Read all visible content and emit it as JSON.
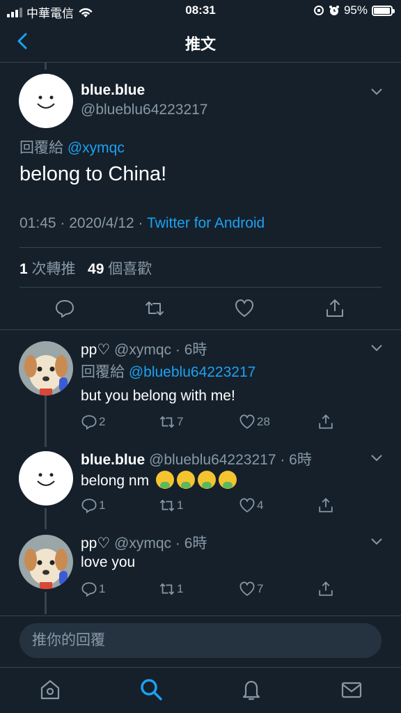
{
  "status": {
    "carrier": "中華電信",
    "time": "08:31",
    "battery": "95%",
    "battery_level": 0.95
  },
  "nav": {
    "title": "推文"
  },
  "main_tweet": {
    "name": "blue.blue",
    "handle": "@blueblu64223217",
    "reply_prefix": "回覆給",
    "reply_to": "@xymqc",
    "text": "belong to China!",
    "time": "01:45",
    "dot1": "·",
    "date": "2020/4/12",
    "dot2": "·",
    "source": "Twitter for Android",
    "retweets": "1",
    "retweets_label": "次轉推",
    "likes": "49",
    "likes_label": "個喜歡"
  },
  "replies": [
    {
      "name": "pp♡",
      "handle": "@xymqc",
      "time": "· 6時",
      "reply_prefix": "回覆給",
      "reply_to": "@blueblu64223217",
      "text": "but you belong with me!",
      "replies": "2",
      "retweets": "7",
      "likes": "28"
    },
    {
      "name": "blue.blue",
      "handle": "@blueblu64223217",
      "time": "· 6時",
      "text": "belong nm",
      "emoji": "nauseated-face",
      "replies": "1",
      "retweets": "1",
      "likes": "4"
    },
    {
      "name": "pp♡",
      "handle": "@xymqc",
      "time": "· 6時",
      "text": "love you",
      "replies": "1",
      "retweets": "1",
      "likes": "7"
    }
  ],
  "composer": {
    "placeholder": "推你的回覆"
  },
  "colors": {
    "background": "#15202b",
    "accent": "#1da1f2",
    "secondary_text": "#8899a6",
    "divider": "#38444d"
  }
}
